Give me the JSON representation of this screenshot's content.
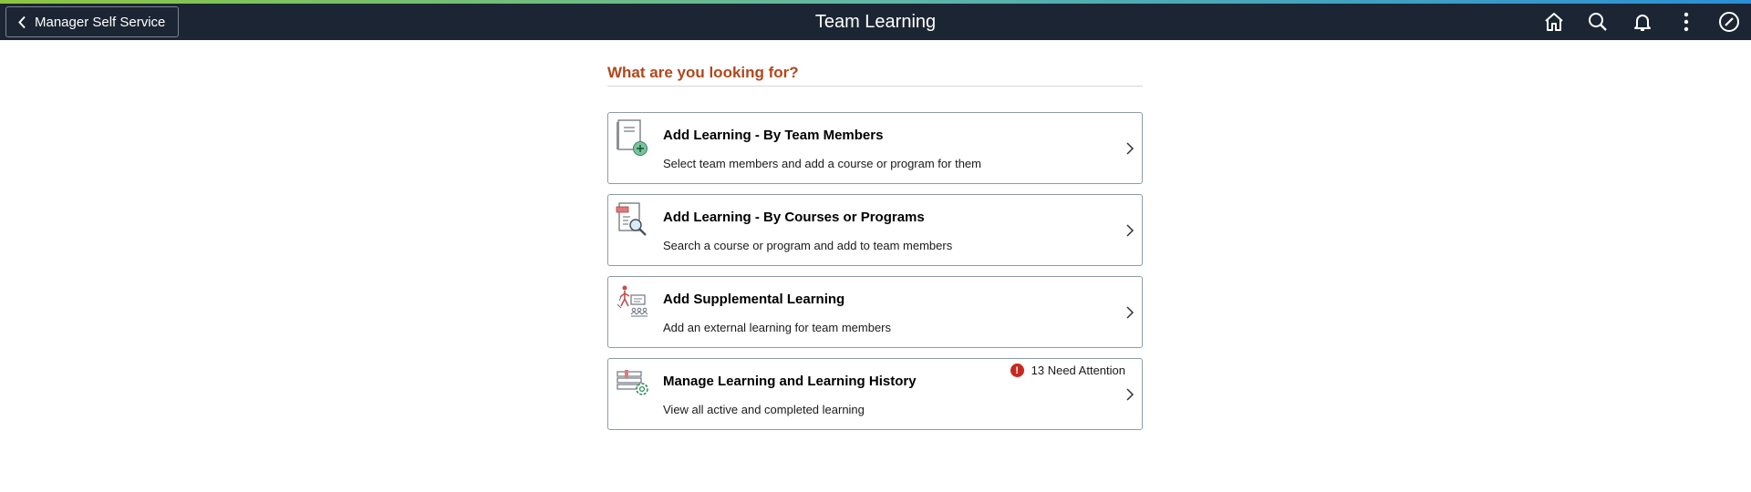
{
  "header": {
    "back_label": "Manager Self Service",
    "title": "Team Learning",
    "icons": [
      "home-icon",
      "search-icon",
      "bell-icon",
      "actions-menu-icon",
      "navbar-compass-icon"
    ]
  },
  "main": {
    "section_heading": "What are you looking for?",
    "tiles": [
      {
        "title": "Add Learning - By Team Members",
        "description": "Select team members and add a course or program for them",
        "icon": "document-add-icon"
      },
      {
        "title": "Add Learning - By Courses or Programs",
        "description": "Search a course or program and add to team members",
        "icon": "document-search-icon"
      },
      {
        "title": "Add Supplemental Learning",
        "description": "Add an external learning for team members",
        "icon": "classroom-icon"
      },
      {
        "title": "Manage Learning and Learning History",
        "description": "View all active and completed learning",
        "icon": "learning-settings-icon",
        "badge": {
          "icon": "!",
          "text": "13 Need Attention"
        }
      }
    ]
  },
  "colors": {
    "header_bg": "#1c2533",
    "heading": "#b2461b",
    "badge": "#c8281f"
  }
}
